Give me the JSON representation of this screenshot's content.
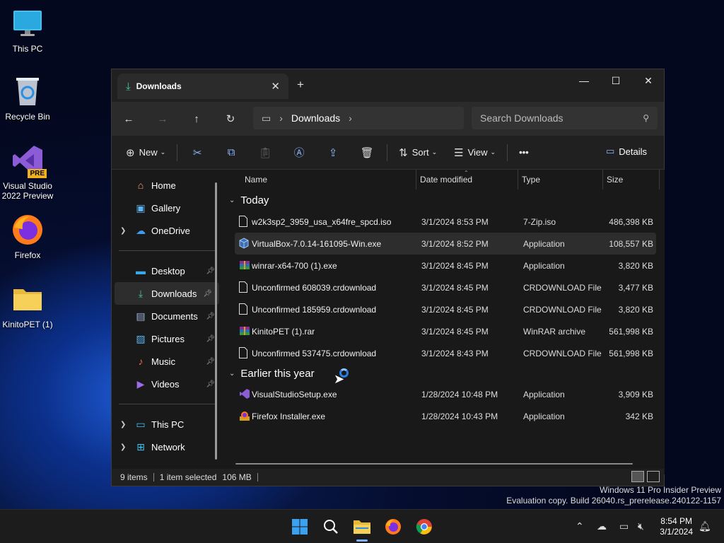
{
  "desktop": {
    "icons": [
      {
        "label": "This PC",
        "icon": "monitor-icon"
      },
      {
        "label": "Recycle Bin",
        "icon": "recycle-bin-icon"
      },
      {
        "label": "Visual Studio 2022 Preview",
        "icon": "visual-studio-icon",
        "badge": "PRE"
      },
      {
        "label": "Firefox",
        "icon": "firefox-icon"
      },
      {
        "label": "KinitoPET (1)",
        "icon": "folder-icon"
      }
    ]
  },
  "window": {
    "tab_title": "Downloads",
    "tab_close": "✕",
    "new_tab": "+",
    "controls": {
      "minimize": "—",
      "maximize": "☐",
      "close": "✕"
    },
    "address": {
      "root_icon": "monitor-icon",
      "crumb": "Downloads",
      "sep": "›"
    },
    "search_placeholder": "Search Downloads",
    "commands": {
      "new": "New",
      "sort": "Sort",
      "view": "View",
      "more": "•••",
      "details": "Details"
    },
    "sidebar": {
      "top": [
        {
          "label": "Home",
          "icon": "home-icon"
        },
        {
          "label": "Gallery",
          "icon": "gallery-icon"
        },
        {
          "label": "OneDrive",
          "icon": "onedrive-icon",
          "expandable": true
        }
      ],
      "pinned": [
        {
          "label": "Desktop",
          "icon": "desktop-icon"
        },
        {
          "label": "Downloads",
          "icon": "download-icon",
          "selected": true
        },
        {
          "label": "Documents",
          "icon": "documents-icon"
        },
        {
          "label": "Pictures",
          "icon": "pictures-icon"
        },
        {
          "label": "Music",
          "icon": "music-icon"
        },
        {
          "label": "Videos",
          "icon": "videos-icon"
        }
      ],
      "bottom": [
        {
          "label": "This PC",
          "icon": "monitor-icon"
        },
        {
          "label": "Network",
          "icon": "network-icon"
        }
      ]
    },
    "columns": {
      "name": "Name",
      "date": "Date modified",
      "type": "Type",
      "size": "Size"
    },
    "groups": [
      {
        "label": "Today",
        "files": [
          {
            "name": "w2k3sp2_3959_usa_x64fre_spcd.iso",
            "date": "3/1/2024 8:53 PM",
            "type": "7-Zip.iso",
            "size": "486,398 KB",
            "icon": "file-icon"
          },
          {
            "name": "VirtualBox-7.0.14-161095-Win.exe",
            "date": "3/1/2024 8:52 PM",
            "type": "Application",
            "size": "108,557 KB",
            "icon": "virtualbox-icon",
            "selected": true
          },
          {
            "name": "winrar-x64-700 (1).exe",
            "date": "3/1/2024 8:45 PM",
            "type": "Application",
            "size": "3,820 KB",
            "icon": "winrar-icon"
          },
          {
            "name": "Unconfirmed 608039.crdownload",
            "date": "3/1/2024 8:45 PM",
            "type": "CRDOWNLOAD File",
            "size": "3,477 KB",
            "icon": "file-icon"
          },
          {
            "name": "Unconfirmed 185959.crdownload",
            "date": "3/1/2024 8:45 PM",
            "type": "CRDOWNLOAD File",
            "size": "3,820 KB",
            "icon": "file-icon"
          },
          {
            "name": "KinitoPET (1).rar",
            "date": "3/1/2024 8:45 PM",
            "type": "WinRAR archive",
            "size": "561,998 KB",
            "icon": "winrar-icon"
          },
          {
            "name": "Unconfirmed 537475.crdownload",
            "date": "3/1/2024 8:43 PM",
            "type": "CRDOWNLOAD File",
            "size": "561,998 KB",
            "icon": "file-icon"
          }
        ]
      },
      {
        "label": "Earlier this year",
        "files": [
          {
            "name": "VisualStudioSetup.exe",
            "date": "1/28/2024 10:48 PM",
            "type": "Application",
            "size": "3,909 KB",
            "icon": "visual-studio-icon"
          },
          {
            "name": "Firefox Installer.exe",
            "date": "1/28/2024 10:43 PM",
            "type": "Application",
            "size": "342 KB",
            "icon": "firefox-icon"
          }
        ]
      }
    ],
    "status": {
      "count": "9 items",
      "selected": "1 item selected",
      "size": "106 MB"
    }
  },
  "watermark": {
    "line1": "Windows 11 Pro Insider Preview",
    "line2": "Evaluation copy. Build 26040.rs_prerelease.240122-1157"
  },
  "taskbar": {
    "time": "8:54 PM",
    "date": "3/1/2024"
  }
}
